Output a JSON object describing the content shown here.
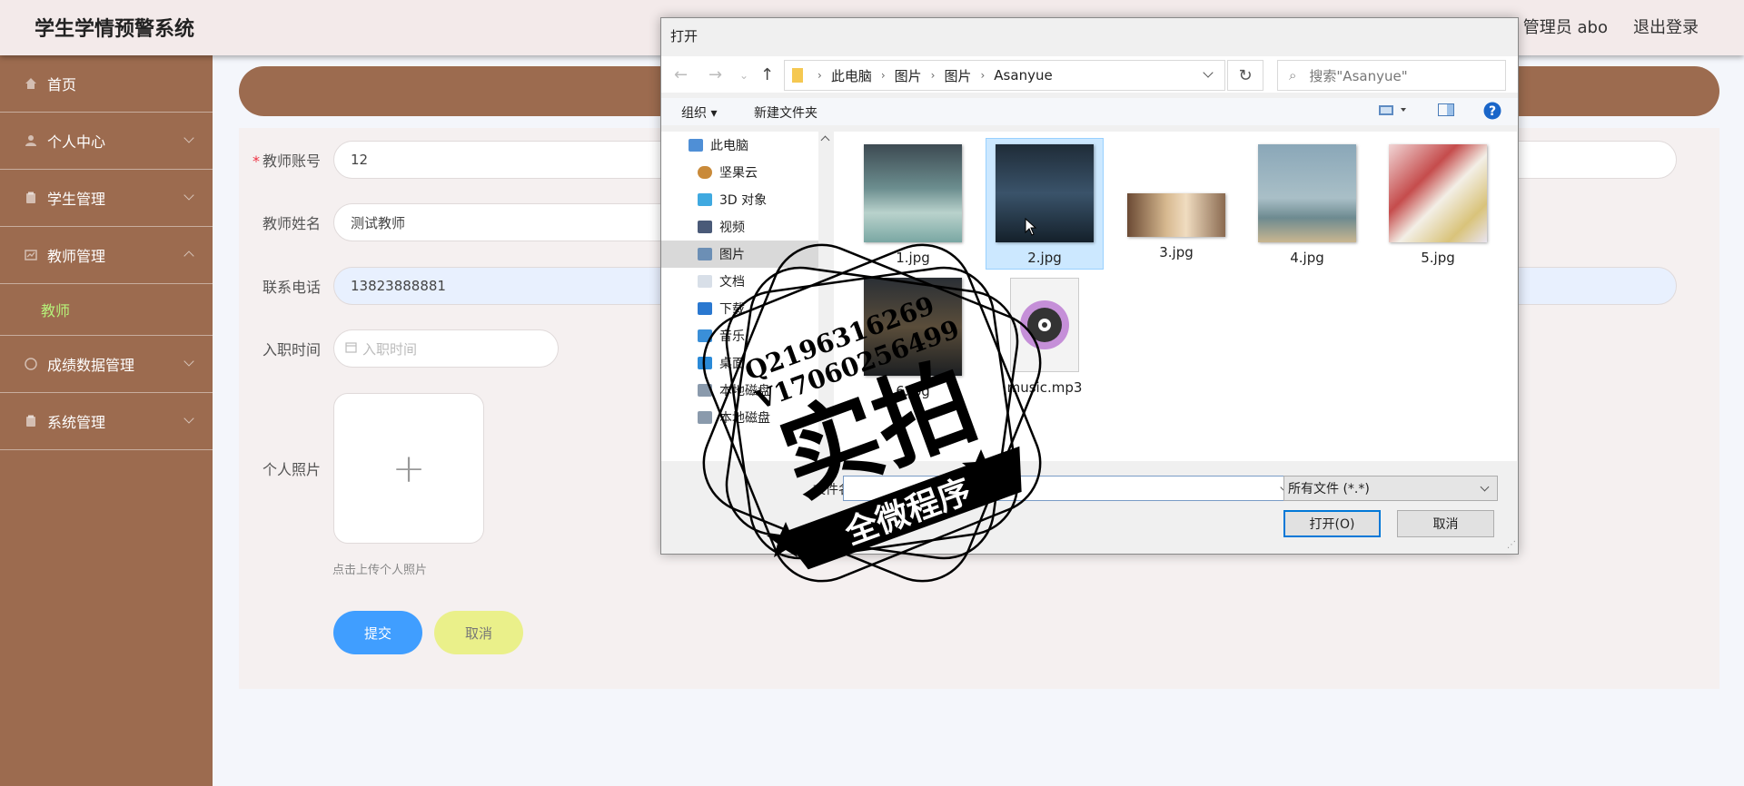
{
  "header": {
    "app_title": "学生学情预警系统",
    "user": "管理员 abo",
    "logout": "退出登录"
  },
  "sidebar": {
    "items": [
      {
        "label": "首页",
        "icon": "home-icon"
      },
      {
        "label": "个人中心",
        "icon": "user-icon"
      },
      {
        "label": "学生管理",
        "icon": "clipboard-icon"
      },
      {
        "label": "教师管理",
        "icon": "chart-icon"
      },
      {
        "label": "成绩数据管理",
        "icon": "compass-icon"
      },
      {
        "label": "系统管理",
        "icon": "clipboard-icon"
      }
    ],
    "sub_item": "教师",
    "accent": "#b6f27a",
    "bg": "#9c6b4f"
  },
  "form": {
    "account_label": "教师账号",
    "account_value": "12",
    "name_label": "教师姓名",
    "name_value": "测试教师",
    "phone_label": "联系电话",
    "phone_value": "13823888881",
    "hire_label": "入职时间",
    "hire_placeholder": "入职时间",
    "photo_label": "个人照片",
    "photo_hint": "点击上传个人照片",
    "submit": "提交",
    "cancel": "取消"
  },
  "dialog": {
    "title": "打开",
    "path": [
      "此电脑",
      "图片",
      "图片",
      "Asanyue"
    ],
    "search_placeholder": "搜索\"Asanyue\"",
    "organize": "组织 ▾",
    "new_folder": "新建文件夹",
    "nav_items": [
      "此电脑",
      "坚果云",
      "3D 对象",
      "视频",
      "图片",
      "文档",
      "下载",
      "音乐",
      "桌面",
      "本地磁盘",
      "本地磁盘"
    ],
    "files": [
      "1.jpg",
      "2.jpg",
      "3.jpg",
      "4.jpg",
      "5.jpg",
      "6.jpg",
      "music.mp3"
    ],
    "filename_label": "文件名",
    "filter": "所有文件 (*.*)",
    "open_button": "打开(O)",
    "cancel_button": "取消"
  },
  "watermark": {
    "line1": "Q2196316269",
    "line2": "V17060256499",
    "main": "实拍",
    "sub": "全微程序"
  }
}
